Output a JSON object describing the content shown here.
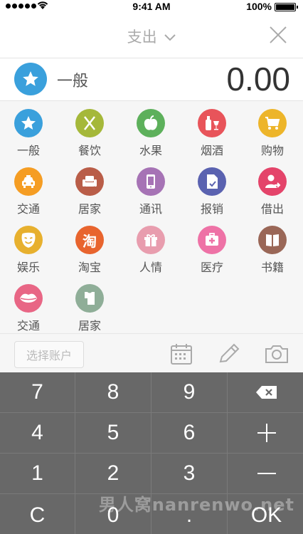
{
  "status": {
    "time": "9:41 AM",
    "battery": "100%"
  },
  "header": {
    "title": "支出"
  },
  "entry": {
    "category": "一般",
    "amount": "0.00"
  },
  "categories": [
    {
      "label": "一般",
      "icon": "star-icon",
      "color": "#3aa0dc"
    },
    {
      "label": "餐饮",
      "icon": "fork-knife-icon",
      "color": "#a5b83a"
    },
    {
      "label": "水果",
      "icon": "apple-icon",
      "color": "#5db05b"
    },
    {
      "label": "烟酒",
      "icon": "bottle-glass-icon",
      "color": "#e8545a"
    },
    {
      "label": "购物",
      "icon": "cart-icon",
      "color": "#edb52a"
    },
    {
      "label": "交通",
      "icon": "taxi-icon",
      "color": "#f59d23"
    },
    {
      "label": "居家",
      "icon": "sofa-icon",
      "color": "#b95d48"
    },
    {
      "label": "通讯",
      "icon": "phone-icon",
      "color": "#a673b5"
    },
    {
      "label": "报销",
      "icon": "document-check-icon",
      "color": "#5a62b0"
    },
    {
      "label": "借出",
      "icon": "person-out-icon",
      "color": "#e4446a"
    },
    {
      "label": "娱乐",
      "icon": "smiley-face-icon",
      "color": "#e7b02e"
    },
    {
      "label": "淘宝",
      "icon": "taobao-icon",
      "color": "#e8642e"
    },
    {
      "label": "人情",
      "icon": "gift-icon",
      "color": "#e89dae"
    },
    {
      "label": "医疗",
      "icon": "medical-kit-icon",
      "color": "#ee72a6"
    },
    {
      "label": "书籍",
      "icon": "book-icon",
      "color": "#9a6757"
    },
    {
      "label": "交通",
      "icon": "lips-icon",
      "color": "#e86685"
    },
    {
      "label": "居家",
      "icon": "shirt-icon",
      "color": "#8fae98"
    }
  ],
  "toolbar": {
    "account_placeholder": "选择账户"
  },
  "keypad": {
    "keys": [
      "7",
      "8",
      "9",
      "⌫",
      "4",
      "5",
      "6",
      "+",
      "1",
      "2",
      "3",
      "—",
      "C",
      "0",
      ".",
      "OK"
    ]
  },
  "watermark": "男人窝nanrenwo.net"
}
